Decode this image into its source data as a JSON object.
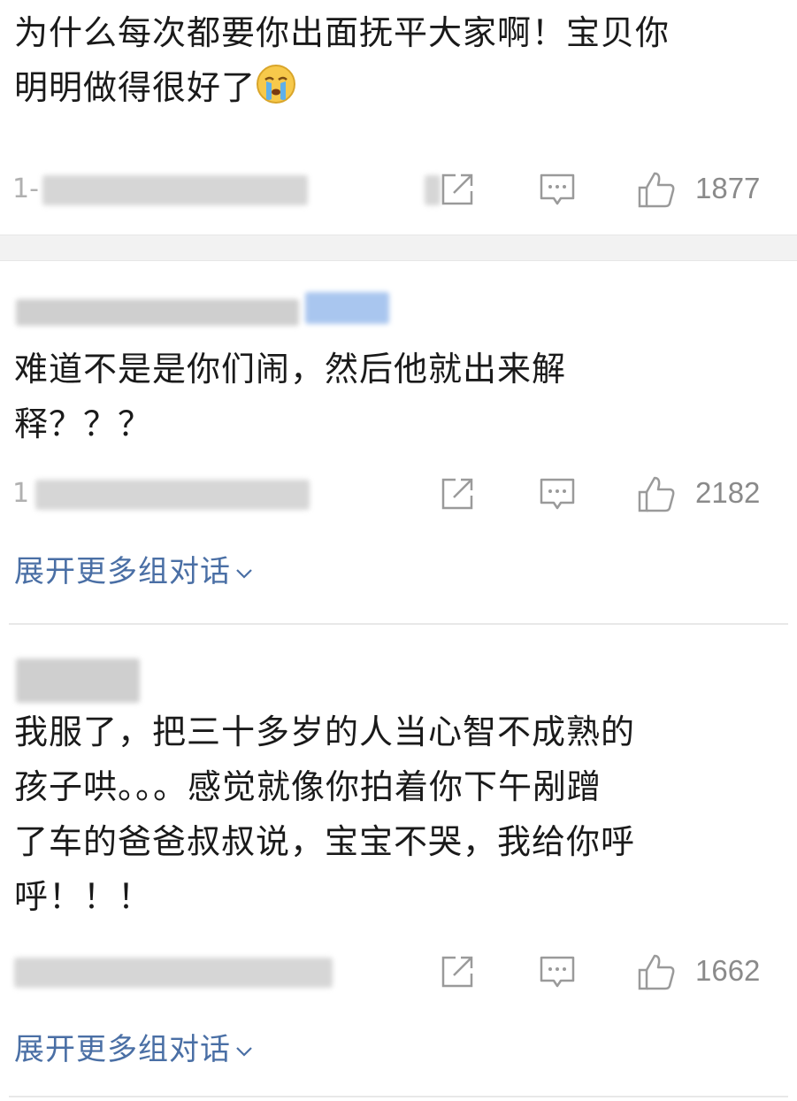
{
  "comments": [
    {
      "text_line1": "为什么每次都要你出面抚平大家啊！宝贝你",
      "text_line2": "明明做得很好了",
      "emoji": "crying-face-icon",
      "meta_prefix": "1-",
      "likes": "1877"
    },
    {
      "text_line1": "难道不是是你们闹，然后他就出来解",
      "text_line2": "释？？？",
      "meta_prefix": "1",
      "likes": "2182",
      "expand_label": "展开更多组对话"
    },
    {
      "text_line1": "我服了，把三十多岁的人当心智不成熟的",
      "text_line2": "孩子哄。。。感觉就像你拍着你下午剐蹭",
      "text_line3": "了车的爸爸叔叔说，宝宝不哭，我给你呼",
      "text_line4": "呼！！！",
      "likes": "1662",
      "expand_label": "展开更多组对话"
    }
  ],
  "icons": {
    "share": "share-icon",
    "comment": "comment-icon",
    "like": "thumbs-up-icon",
    "expand": "chevron-down-icon"
  },
  "colors": {
    "link": "#4a6fa5",
    "meta": "#8a8a8a"
  }
}
